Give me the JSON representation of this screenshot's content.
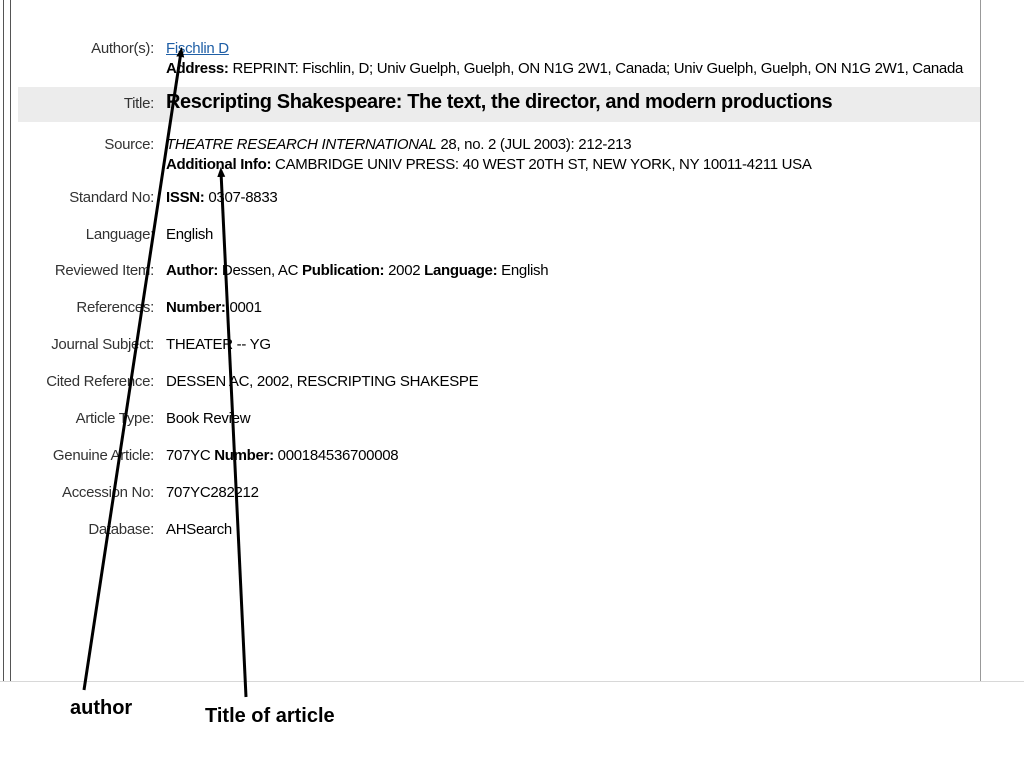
{
  "record": {
    "author": {
      "label": "Author(s):",
      "name": "Fischlin D",
      "address_label": "Address:",
      "address": " REPRINT: Fischlin, D; Univ Guelph, Guelph, ON N1G 2W1, Canada; Univ Guelph, Guelph, ON N1G 2W1, Canada"
    },
    "title": {
      "label": "Title:",
      "value": "Rescripting Shakespeare: The text, the director, and modern productions"
    },
    "source": {
      "label": "Source:",
      "journal": "THEATRE RESEARCH INTERNATIONAL",
      "details": " 28, no. 2 (JUL 2003): 212-213",
      "additional_label": "Additional Info:",
      "additional": " CAMBRIDGE UNIV PRESS: 40 WEST 20TH ST, NEW YORK, NY 10011-4211 USA"
    },
    "standard_no": {
      "label": "Standard No:",
      "key": "ISSN:",
      "value": " 0307-8833"
    },
    "language": {
      "label": "Language:",
      "value": "English"
    },
    "reviewed_item": {
      "label": "Reviewed Item:",
      "author_key": "Author:",
      "author": " Dessen, AC ",
      "pub_key": "Publication:",
      "pub": " 2002 ",
      "lang_key": "Language:",
      "lang": " English"
    },
    "references": {
      "label": "References:",
      "key": "Number:",
      "value": " 0001"
    },
    "journal_subject": {
      "label": "Journal Subject:",
      "value": "THEATER -- YG"
    },
    "cited_reference": {
      "label": "Cited Reference:",
      "value": "DESSEN AC, 2002, RESCRIPTING SHAKESPE"
    },
    "article_type": {
      "label": "Article Type:",
      "value": "Book Review"
    },
    "genuine_article": {
      "label": "Genuine Article:",
      "value": "707YC ",
      "key": "Number:",
      "number": " 000184536700008"
    },
    "accession_no": {
      "label": "Accession No:",
      "value": "707YC282212"
    },
    "database": {
      "label": "Database:",
      "value": "AHSearch"
    }
  },
  "annotations": {
    "author_label": "author",
    "title_label": "Title of article"
  }
}
